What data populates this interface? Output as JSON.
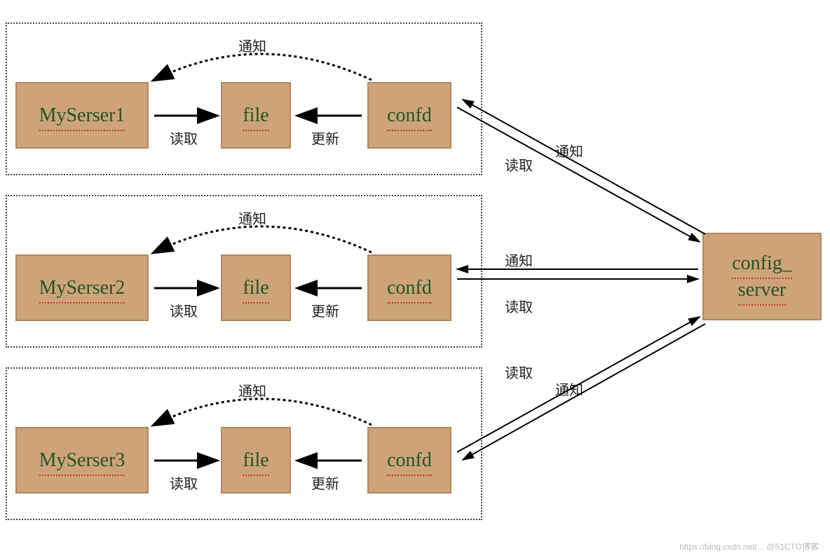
{
  "groups": [
    {
      "notify_top": "通知",
      "service": "MySerser1",
      "file": "file",
      "confd": "confd",
      "read": "读取",
      "update": "更新"
    },
    {
      "notify_top": "通知",
      "service": "MySerser2",
      "file": "file",
      "confd": "confd",
      "read": "读取",
      "update": "更新"
    },
    {
      "notify_top": "通知",
      "service": "MySerser3",
      "file": "file",
      "confd": "confd",
      "read": "读取",
      "update": "更新"
    }
  ],
  "config_server": {
    "line1": "config_",
    "line2": "server"
  },
  "ext": {
    "top": {
      "read": "读取",
      "notify": "通知"
    },
    "mid": {
      "read": "读取",
      "notify": "通知"
    },
    "bot": {
      "read": "读取",
      "notify": "通知"
    }
  },
  "watermark": "https://blog.csdn.net/... @51CTO博客"
}
